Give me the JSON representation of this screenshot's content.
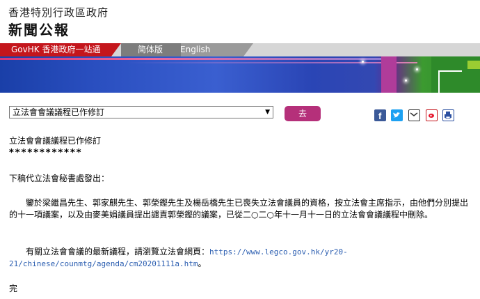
{
  "masthead": {
    "line1": "香港特別行政區政府",
    "line2": "新聞公報"
  },
  "nav": {
    "govhk": "GovHK 香港政府一站通",
    "simplified": "简体版",
    "english": "English"
  },
  "toolbar": {
    "select_value": "立法會會議議程已作修訂",
    "go_label": "去"
  },
  "share_icons": [
    "facebook-icon",
    "twitter-icon",
    "email-icon",
    "weibo-icon",
    "print-icon"
  ],
  "article": {
    "title": "立法會會議議程已作修訂",
    "stars": "************",
    "byline": "下稿代立法會秘書處發出：",
    "paragraph1": "鑒於梁繼昌先生、郭家麒先生、郭榮鏗先生及楊岳橋先生已喪失立法會議員的資格，按立法會主席指示，由他們分別提出的十一項議案，以及由麥美娟議員提出譴責郭榮鏗的議案，已從二○二○年十一月十一日的立法會會議議程中刪除。",
    "paragraph2_prefix": "有關立法會會議的最新議程，請瀏覽立法會網頁：",
    "paragraph2_link": "https://www.legco.gov.hk/yr20-21/chinese/counmtg/agenda/cm20201111a.htm",
    "paragraph2_suffix": "。",
    "end": "完"
  },
  "colors": {
    "gov_red": "#c4161c",
    "go_button": "#b5307a",
    "link": "#2a5db0"
  }
}
